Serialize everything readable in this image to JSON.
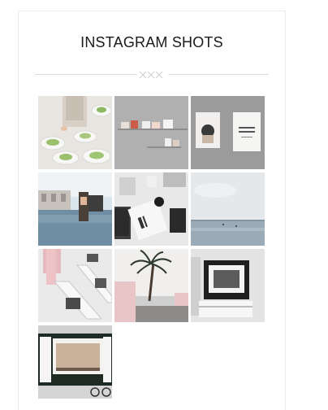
{
  "widget": {
    "title": "INSTAGRAM SHOTS"
  },
  "shots": [
    {
      "subject": "salad-plates-photo"
    },
    {
      "subject": "shelf-photo"
    },
    {
      "subject": "books-photo"
    },
    {
      "subject": "poolside-photo"
    },
    {
      "subject": "desk-flatlay-photo"
    },
    {
      "subject": "seascape-photo"
    },
    {
      "subject": "loungers-photo"
    },
    {
      "subject": "palm-tree-photo"
    },
    {
      "subject": "framed-art-photo"
    },
    {
      "subject": "storefront-photo"
    }
  ]
}
